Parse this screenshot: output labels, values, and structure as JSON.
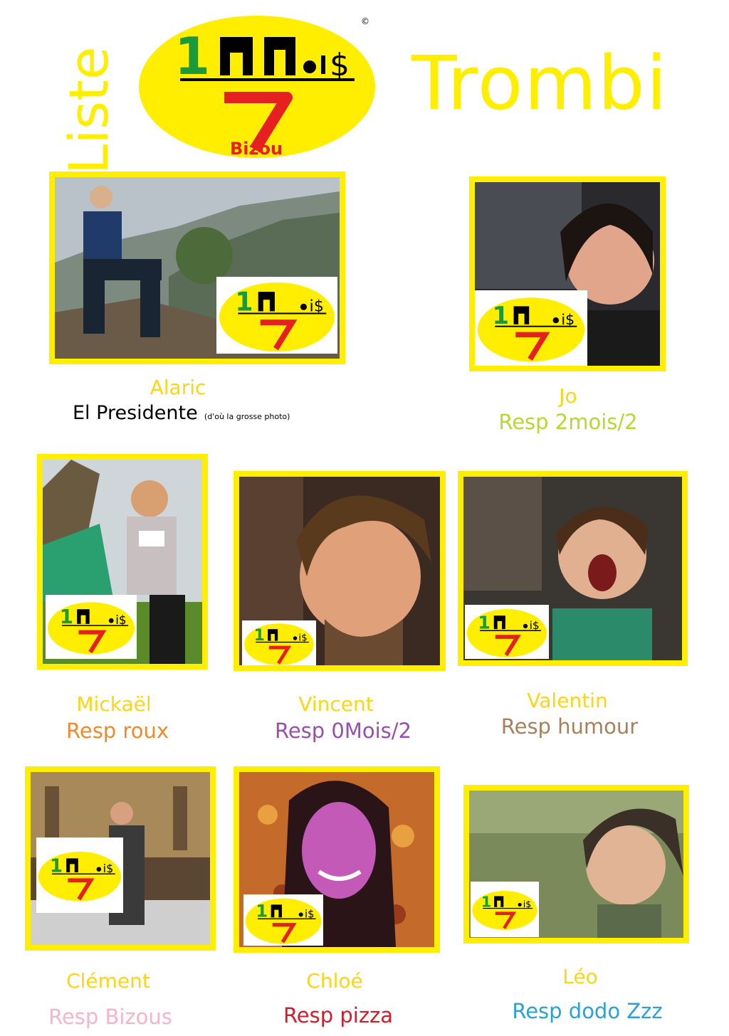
{
  "header": {
    "liste": "Liste",
    "trombi": "Trombi"
  },
  "logo": {
    "one": "1",
    "mois": "Mois",
    "two": "2",
    "bizou": "Bizou",
    "copyright": "©"
  },
  "members": [
    {
      "name": "Alaric",
      "role": "El Presidente",
      "note": "(d'où la grosse photo)",
      "role_color": "#000000"
    },
    {
      "name": "Jo",
      "role": "Resp 2mois/2",
      "role_color": "#b5d92e"
    },
    {
      "name": "Mickaël",
      "role": "Resp roux",
      "role_color": "#f08a2a"
    },
    {
      "name": "Vincent",
      "role": "Resp 0Mois/2",
      "role_color": "#9a4fae"
    },
    {
      "name": "Valentin",
      "role": "Resp humour",
      "role_color": "#a8815c"
    },
    {
      "name": "Clément",
      "role": "Resp Bizous",
      "role_color": "#f7b3c8"
    },
    {
      "name": "Chloé",
      "role": "Resp pizza",
      "role_color": "#d41c2c"
    },
    {
      "name": "Léo",
      "role": "Resp dodo Zzz",
      "role_color": "#2aa2d8"
    }
  ],
  "colors": {
    "frame": "#ffee00",
    "title": "#ffee00",
    "name": "#ffd414",
    "logo_fill": "#ffee00",
    "logo_red": "#e62020",
    "logo_green": "#1a9a3a"
  }
}
